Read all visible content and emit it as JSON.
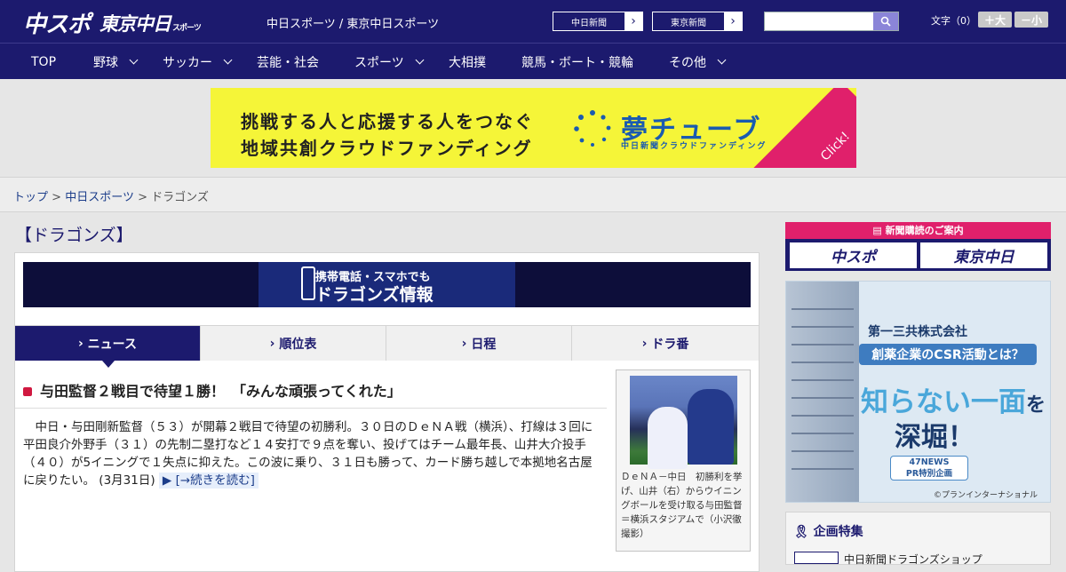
{
  "header": {
    "logo_main": "中スポ",
    "logo_tokyo": "東京中日",
    "logo_tokyo_suffix": "スポーツ",
    "site_title": "中日スポーツ / 東京中日スポーツ",
    "paper_links": [
      "中日新聞",
      "東京新聞"
    ],
    "font_size_label": "文字（0）",
    "font_plus": "＋大",
    "font_minus": "－小"
  },
  "nav": [
    {
      "label": "TOP",
      "dropdown": false
    },
    {
      "label": "野球",
      "dropdown": true
    },
    {
      "label": "サッカー",
      "dropdown": true
    },
    {
      "label": "芸能・社会",
      "dropdown": false
    },
    {
      "label": "スポーツ",
      "dropdown": true
    },
    {
      "label": "大相撲",
      "dropdown": false
    },
    {
      "label": "競馬・ボート・競輪",
      "dropdown": false
    },
    {
      "label": "その他",
      "dropdown": true
    }
  ],
  "banner": {
    "line1": "挑戦する人と応援する人をつなぐ",
    "line2": "地域共創クラウドファンディング",
    "brand": "夢チューブ",
    "brand_sub": "中日新聞クラウドファンディング",
    "click": "Click!"
  },
  "breadcrumb": {
    "items": [
      "トップ",
      "中日スポーツ",
      "ドラゴンズ"
    ],
    "sep": ">"
  },
  "page_title": "【ドラゴンズ】",
  "mobile_banner": {
    "line1": "携帯電話・スマホでも",
    "line2": "ドラゴンズ情報"
  },
  "tabs": [
    "ニュース",
    "順位表",
    "日程",
    "ドラ番"
  ],
  "article": {
    "headline": "与田監督２戦目で待望１勝！　「みんな頑張ってくれた」",
    "body": "中日・与田剛新監督（５３）が開幕２戦目で待望の初勝利。３０日のＤｅＮＡ戦（横浜）、打線は３回に平田良介外野手（３１）の先制二塁打など１４安打で９点を奪い、投げてはチーム最年長、山井大介投手（４０）が5イニングで１失点に抑えた。この波に乗り、３１日も勝って、カード勝ち越しで本拠地名古屋に戻りたい。",
    "date": "(3月31日)",
    "more": "[→続きを読む]",
    "caption": "ＤｅＮＡ－中日　初勝利を挙げ、山井（右）からウイニングボールを受け取る与田監督＝横浜スタジアムで（小沢徹撮影）"
  },
  "sidebar": {
    "subscribe_header": "新聞購読のご案内",
    "subscribe_logos": [
      "中スポ",
      "東京中日"
    ],
    "ad": {
      "company": "第一三共株式会社",
      "pill": "創薬企業のCSR活動とは？",
      "big1": "知らない一面",
      "big1_suffix": "を",
      "big2": "深堀！",
      "badge_line1": "47NEWS",
      "badge_line2": "PR特別企画",
      "copyright": "©プランインターナショナル"
    },
    "feature_title": "企画特集",
    "feature_item": "中日新聞ドラゴンズショップ"
  }
}
